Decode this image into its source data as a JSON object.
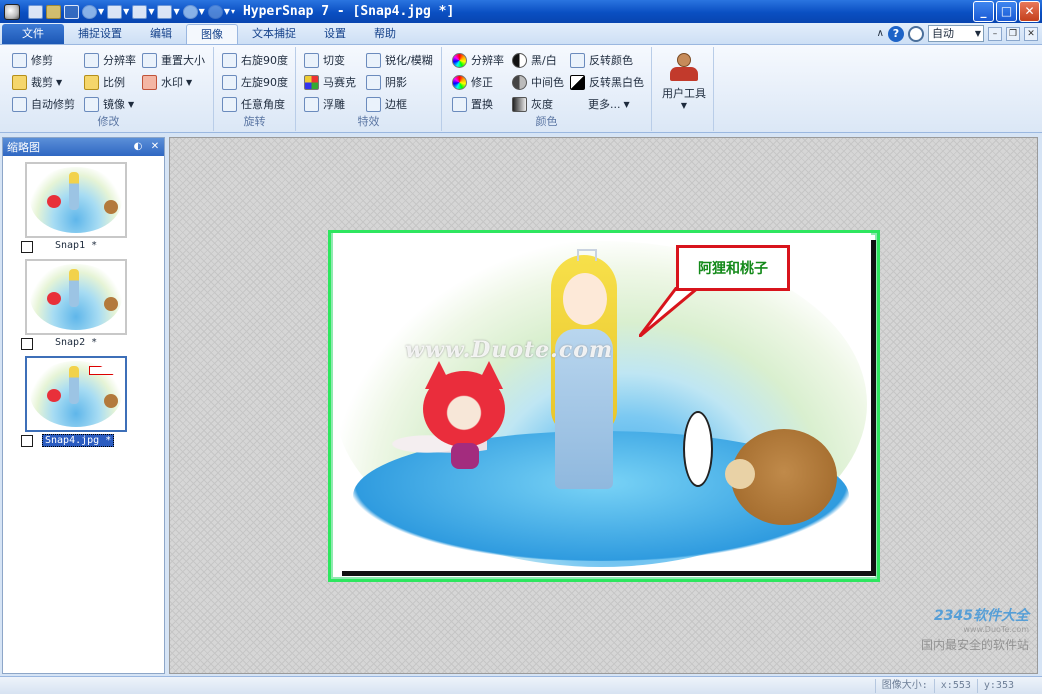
{
  "window": {
    "title": "HyperSnap 7 - [Snap4.jpg *]",
    "controls": [
      "_",
      "□",
      "✕"
    ]
  },
  "quick_access": {
    "icons": [
      "new-icon",
      "open-folder-icon",
      "save-icon",
      "share-icon",
      "print-icon",
      "window-icon",
      "capture-icon",
      "undo-icon",
      "redo-icon"
    ]
  },
  "tabs": [
    "文件",
    "捕捉设置",
    "编辑",
    "图像",
    "文本捕捉",
    "设置",
    "帮助"
  ],
  "active_tab": "图像",
  "zoom": {
    "value": "自动"
  },
  "ribbon": {
    "modify": {
      "label": "修改",
      "items": [
        "修剪",
        "分辨率",
        "重置大小",
        "裁剪",
        "比例",
        "水印",
        "自动修剪",
        "镜像"
      ]
    },
    "rotate": {
      "label": "旋转",
      "items": [
        "右旋90度",
        "左旋90度",
        "任意角度"
      ]
    },
    "effects": {
      "label": "特效",
      "items": [
        "切变",
        "锐化/模糊",
        "马赛克",
        "阴影",
        "浮雕",
        "边框"
      ]
    },
    "color": {
      "label": "颜色",
      "items": [
        "分辨率",
        "黑/白",
        "反转颜色",
        "修正",
        "中间色",
        "反转黑白色",
        "置换",
        "灰度",
        "更多..."
      ]
    },
    "user_tools": {
      "label": "用户工具"
    }
  },
  "thumbnails": {
    "title": "缩略图",
    "items": [
      {
        "label": "Snap1 *"
      },
      {
        "label": "Snap2 *"
      },
      {
        "label": "Snap4.jpg *"
      }
    ]
  },
  "image": {
    "bubble_text": "阿狸和桃子",
    "watermark": "www.Duote.com"
  },
  "site_watermark": {
    "logo": "2345软件大全",
    "url": "www.DuoTe.com",
    "tagline": "国内最安全的软件站"
  },
  "status": {
    "size_label": "图像大小:",
    "x": "x:553",
    "y": "y:353"
  }
}
